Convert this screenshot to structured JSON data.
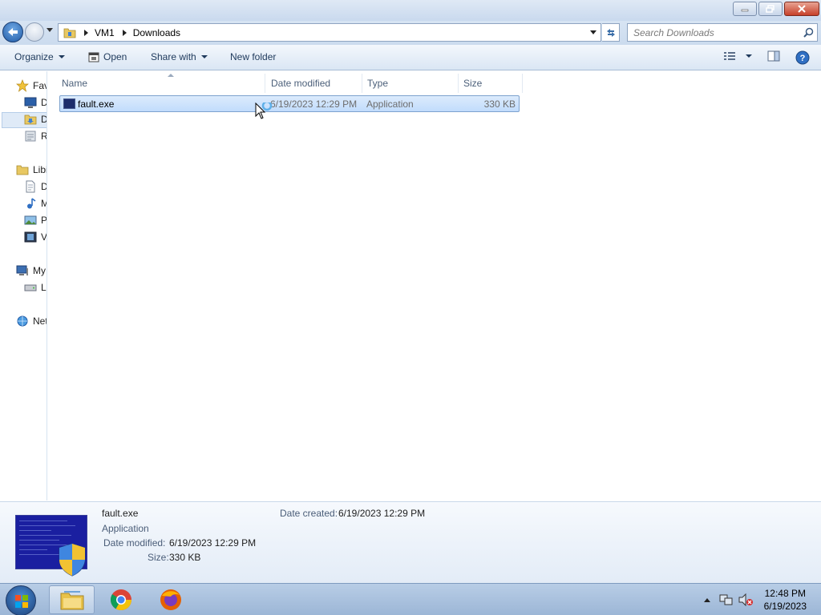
{
  "window": {
    "controls": [
      "minimize",
      "restore",
      "close"
    ]
  },
  "address": {
    "breadcrumbs": [
      "VM1",
      "Downloads"
    ],
    "search_placeholder": "Search Downloads"
  },
  "commands": {
    "organize": "Organize",
    "open": "Open",
    "share_with": "Share with",
    "new_folder": "New folder"
  },
  "nav_pane": {
    "items": [
      {
        "label": "Fav",
        "icon": "star-icon"
      },
      {
        "label": "D",
        "icon": "desktop-icon"
      },
      {
        "label": "D",
        "icon": "downloads-folder-icon",
        "selected": true
      },
      {
        "label": "R",
        "icon": "recent-places-icon"
      },
      {
        "label": "Libi",
        "icon": "libraries-icon"
      },
      {
        "label": "D",
        "icon": "documents-icon"
      },
      {
        "label": "M",
        "icon": "music-icon"
      },
      {
        "label": "P",
        "icon": "pictures-icon"
      },
      {
        "label": "V",
        "icon": "videos-icon"
      },
      {
        "label": "My",
        "icon": "computer-icon"
      },
      {
        "label": "L",
        "icon": "local-disk-icon"
      },
      {
        "label": "Net",
        "icon": "network-icon"
      }
    ]
  },
  "file_list": {
    "columns": [
      "Name",
      "Date modified",
      "Type",
      "Size"
    ],
    "rows": [
      {
        "name": "fault.exe",
        "date_modified": "6/19/2023 12:29 PM",
        "type": "Application",
        "size": "330 KB",
        "selected": true
      }
    ]
  },
  "details": {
    "name": "fault.exe",
    "type": "Application",
    "date_modified_label": "Date modified:",
    "date_modified": "6/19/2023 12:29 PM",
    "size_label": "Size:",
    "size": "330 KB",
    "date_created_label": "Date created:",
    "date_created": "6/19/2023 12:29 PM"
  },
  "taskbar": {
    "apps": [
      "windows-explorer-icon",
      "chrome-icon",
      "firefox-icon"
    ],
    "time": "12:48 PM",
    "date": "6/19/2023"
  },
  "colors": {
    "selection": "#c1dcfc",
    "accent": "#1e395b"
  }
}
